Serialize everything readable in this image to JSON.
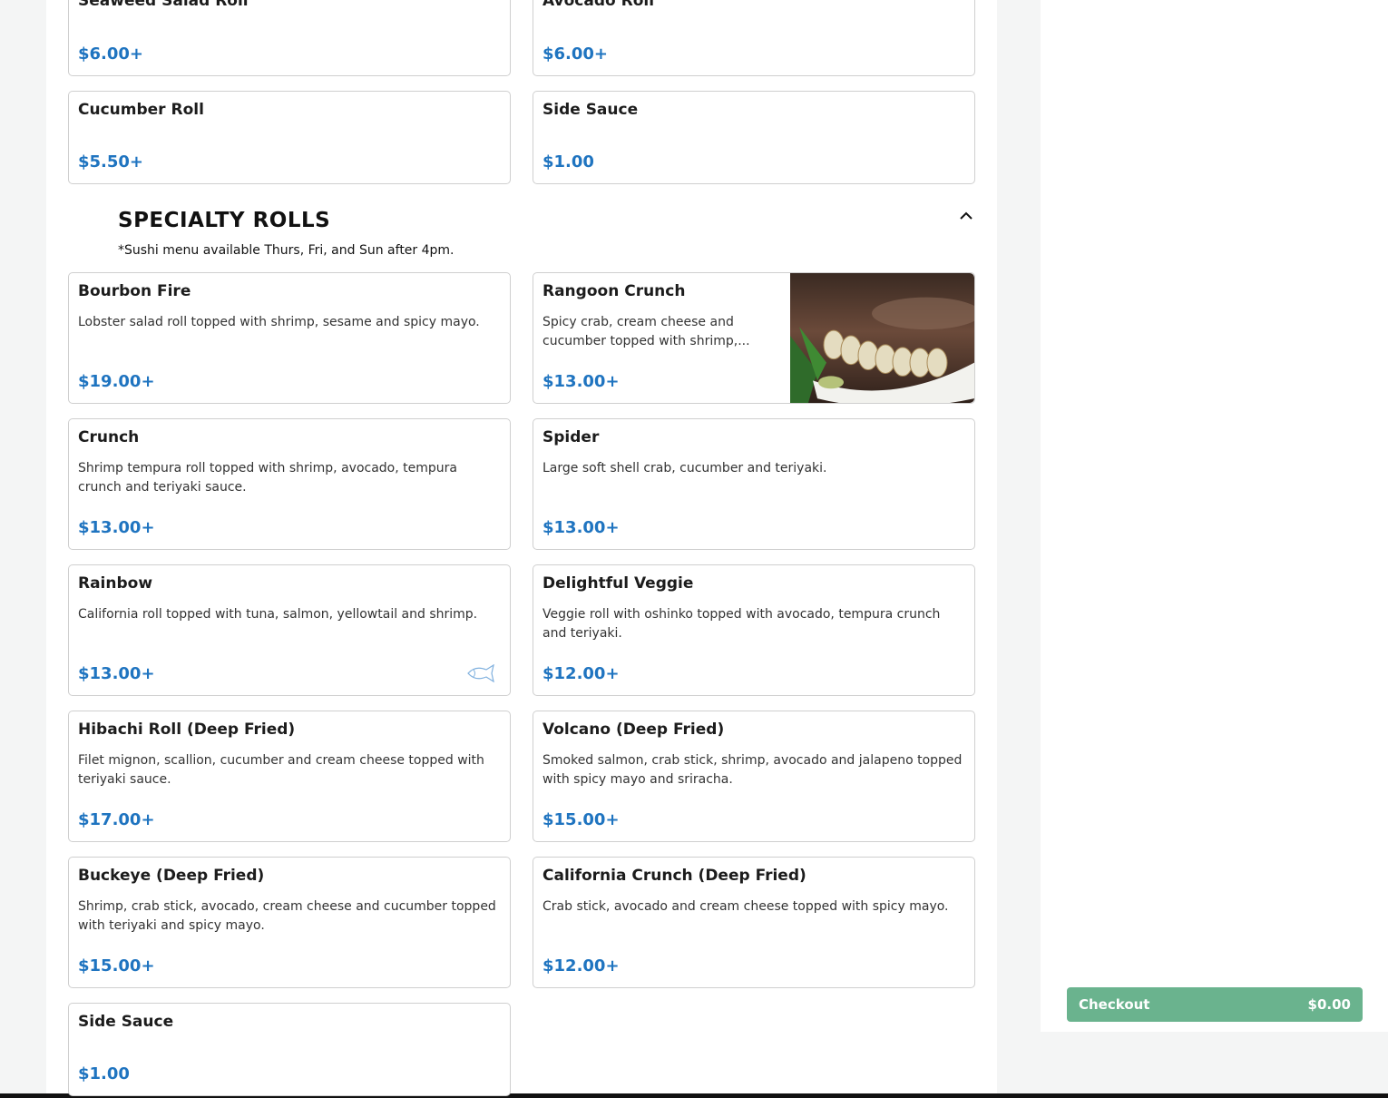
{
  "top_items": [
    {
      "name": "Seaweed Salad Roll",
      "price": "$6.00+"
    },
    {
      "name": "Avocado Roll",
      "price": "$6.00+"
    },
    {
      "name": "Cucumber Roll",
      "price": "$5.50+"
    },
    {
      "name": "Side Sauce",
      "price": "$1.00"
    }
  ],
  "specialty": {
    "title": "SPECIALTY ROLLS",
    "note": "*Sushi menu available Thurs, Fri, and Sun after 4pm.",
    "collapse_icon": "chevron-up-icon",
    "items": [
      {
        "name": "Bourbon Fire",
        "desc": "Lobster salad roll topped with shrimp, sesame and spicy mayo.",
        "price": "$19.00+"
      },
      {
        "name": "Rangoon Crunch",
        "desc": "Spicy crab, cream cheese and cucumber topped with shrimp,...",
        "price": "$13.00+",
        "image": "sushi-roll-photo"
      },
      {
        "name": "Crunch",
        "desc": "Shrimp tempura roll topped with shrimp, avocado, tempura crunch and teriyaki sauce.",
        "price": "$13.00+"
      },
      {
        "name": "Spider",
        "desc": "Large soft shell crab, cucumber and teriyaki.",
        "price": "$13.00+"
      },
      {
        "name": "Rainbow",
        "desc": "California roll topped with tuna, salmon, yellowtail and shrimp.",
        "price": "$13.00+",
        "badge_icon": "fish-icon"
      },
      {
        "name": "Delightful Veggie",
        "desc": "Veggie roll with oshinko topped with avocado, tempura crunch and teriyaki.",
        "price": "$12.00+"
      },
      {
        "name": "Hibachi Roll (Deep Fried)",
        "desc": "Filet mignon, scallion, cucumber and cream cheese topped with teriyaki sauce.",
        "price": "$17.00+"
      },
      {
        "name": "Volcano (Deep Fried)",
        "desc": "Smoked salmon, crab stick, shrimp, avocado and jalapeno topped with spicy mayo and sriracha.",
        "price": "$15.00+"
      },
      {
        "name": "Buckeye (Deep Fried)",
        "desc": "Shrimp, crab stick, avocado, cream cheese and cucumber topped with teriyaki and spicy mayo.",
        "price": "$15.00+"
      },
      {
        "name": "California Crunch (Deep Fried)",
        "desc": "Crab stick, avocado and cream cheese topped with spicy mayo.",
        "price": "$12.00+"
      },
      {
        "name": "Side Sauce",
        "price": "$1.00"
      }
    ]
  },
  "cart": {
    "checkout_label": "Checkout",
    "total": "$0.00"
  },
  "colors": {
    "price": "#1f74c0",
    "checkout": "#6ab38e",
    "background": "#f4f5f5"
  }
}
